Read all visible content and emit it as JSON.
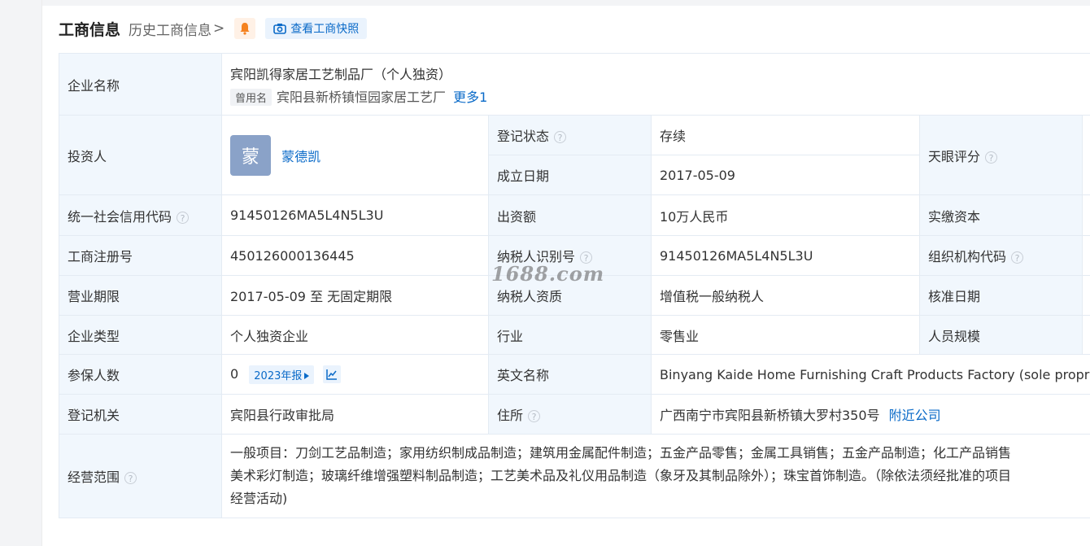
{
  "header": {
    "title": "工商信息",
    "history_link": "历史工商信息",
    "history_arrow": ">",
    "snapshot_button": "查看工商快照"
  },
  "company": {
    "name_label": "企业名称",
    "name": "宾阳凯得家居工艺制品厂（个人独资）",
    "used_name_tag": "曾用名",
    "used_name": "宾阳县新桥镇恒园家居工艺厂",
    "more_link": "更多1"
  },
  "investor": {
    "label": "投资人",
    "avatar_char": "蒙",
    "name": "蒙德凯"
  },
  "registration_status": {
    "label": "登记状态",
    "value": "存续"
  },
  "established_date": {
    "label": "成立日期",
    "value": "2017-05-09"
  },
  "tianyan_score": {
    "label": "天眼评分"
  },
  "credit_code": {
    "label": "统一社会信用代码",
    "value": "91450126MA5L4N5L3U"
  },
  "capital": {
    "label": "出资额",
    "value": "10万人民币"
  },
  "paid_capital": {
    "label": "实缴资本"
  },
  "reg_number": {
    "label": "工商注册号",
    "value": "450126000136445"
  },
  "taxpayer_id": {
    "label": "纳税人识别号",
    "value": "91450126MA5L4N5L3U"
  },
  "org_code": {
    "label": "组织机构代码"
  },
  "business_term": {
    "label": "营业期限",
    "value": "2017-05-09 至 无固定期限"
  },
  "taxpayer_qual": {
    "label": "纳税人资质",
    "value": "增值税一般纳税人"
  },
  "approval_date": {
    "label": "核准日期"
  },
  "company_type": {
    "label": "企业类型",
    "value": "个人独资企业"
  },
  "industry": {
    "label": "行业",
    "value": "零售业"
  },
  "staff_size": {
    "label": "人员规模"
  },
  "insured": {
    "label": "参保人数",
    "value": "0",
    "report": "2023年报"
  },
  "english_name": {
    "label": "英文名称",
    "value": "Binyang Kaide Home Furnishing Craft Products Factory (sole proprie"
  },
  "registration_authority": {
    "label": "登记机关",
    "value": "宾阳县行政审批局"
  },
  "address": {
    "label": "住所",
    "value": "广西南宁市宾阳县新桥镇大罗村350号",
    "nearby_link": "附近公司"
  },
  "business_scope": {
    "label": "经营范围",
    "line1": "一般项目：刀剑工艺品制造；家用纺织制成品制造；建筑用金属配件制造；五金产品零售；金属工具销售；五金产品制造；化工产品销售",
    "line2": "美术彩灯制造；玻璃纤维增强塑料制品制造；工艺美术品及礼仪用品制造（象牙及其制品除外）；珠宝首饰制造。（除依法须经批准的项目",
    "line3": "经营活动)"
  },
  "help_glyph": "?",
  "watermark": "1688.com",
  "colors": {
    "link": "#0a6ac8",
    "status_green": "#18a153",
    "label_bg": "#f1f7fd"
  }
}
